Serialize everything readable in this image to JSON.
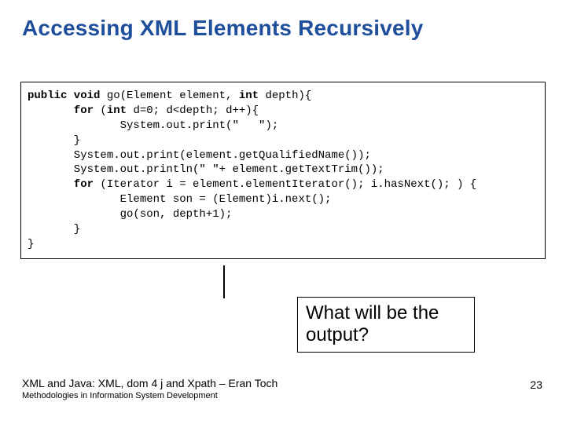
{
  "title": "Accessing XML Elements Recursively",
  "code": {
    "l0a": "public void",
    "l0b": " go(Element element, ",
    "l0c": "int",
    "l0d": " depth){",
    "l1a": "       for",
    "l1b": " (",
    "l1c": "int",
    "l1d": " d=0; d<depth; d++){",
    "l2": "              System.out.print(\"   \");",
    "l3": "       }",
    "l4": "       System.out.print(element.getQualifiedName());",
    "l5": "       System.out.println(\" \"+ element.getTextTrim());",
    "l6a": "       for",
    "l6b": " (Iterator i = element.elementIterator(); i.hasNext(); ) {",
    "l7": "              Element son = (Element)i.next();",
    "l8": "              go(son, depth+1);",
    "l9": "       }",
    "l10": "}"
  },
  "callout": "What will be the output?",
  "footer_main": "XML and Java: XML, dom 4 j and Xpath – Eran Toch",
  "footer_sub": "Methodologies in Information System Development",
  "page_number": "23"
}
